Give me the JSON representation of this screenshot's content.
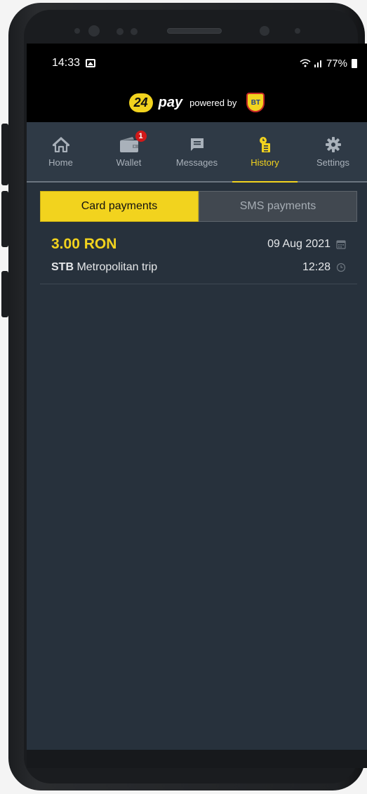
{
  "status_bar": {
    "time": "14:33",
    "battery": "77%"
  },
  "brand": {
    "logo_number": "24",
    "logo_word": "pay",
    "powered_by": "powered by",
    "partner_logo": "BT"
  },
  "nav": {
    "items": [
      {
        "label": "Home",
        "icon": "home-icon"
      },
      {
        "label": "Wallet",
        "icon": "wallet-icon",
        "badge": "1"
      },
      {
        "label": "Messages",
        "icon": "messages-icon"
      },
      {
        "label": "History",
        "icon": "history-icon",
        "active": true
      },
      {
        "label": "Settings",
        "icon": "settings-icon"
      }
    ]
  },
  "tabs": {
    "card": "Card payments",
    "sms": "SMS payments"
  },
  "transactions": [
    {
      "amount": "3.00 RON",
      "date": "09 Aug 2021",
      "operator": "STB",
      "description": "Metropolitan trip",
      "time": "12:28"
    }
  ],
  "colors": {
    "accent": "#f2d31e",
    "background": "#27313c",
    "nav_bg": "#2f3a46",
    "badge": "#d11919"
  }
}
